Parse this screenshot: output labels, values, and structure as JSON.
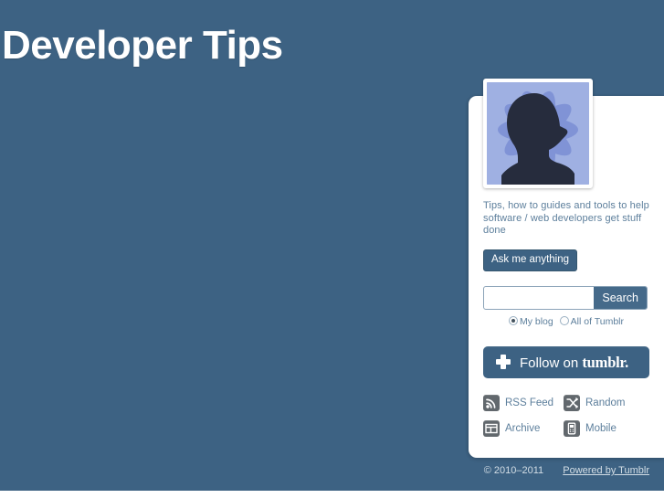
{
  "theme": {
    "background_color": "#3d6283",
    "panel_color": "#ffffff",
    "accent_color": "#3d6283",
    "muted_text_color": "#5d7f9c",
    "icon_color": "#62686d",
    "avatar_bg_color": "#9fb0e2"
  },
  "header": {
    "blog_title": "Developer Tips"
  },
  "sidebar": {
    "avatar_alt": "avatar-head-silhouette",
    "description": "Tips, how to guides and tools to help software / web developers get stuff done",
    "ask_label": "Ask me anything",
    "search": {
      "value": "",
      "placeholder": "",
      "button_label": "Search",
      "scopes": [
        {
          "label": "My blog",
          "checked": true
        },
        {
          "label": "All of Tumblr",
          "checked": false
        }
      ]
    },
    "follow": {
      "label": "Follow on",
      "brand": "tumblr.",
      "icon": "plus-icon"
    },
    "links": [
      {
        "label": "RSS Feed",
        "icon": "rss-icon"
      },
      {
        "label": "Random",
        "icon": "shuffle-icon"
      },
      {
        "label": "Archive",
        "icon": "grid-icon"
      },
      {
        "label": "Mobile",
        "icon": "mobile-phone-icon"
      }
    ]
  },
  "footer": {
    "copyright": "© 2010–2011",
    "powered_by": "Powered by Tumblr"
  }
}
